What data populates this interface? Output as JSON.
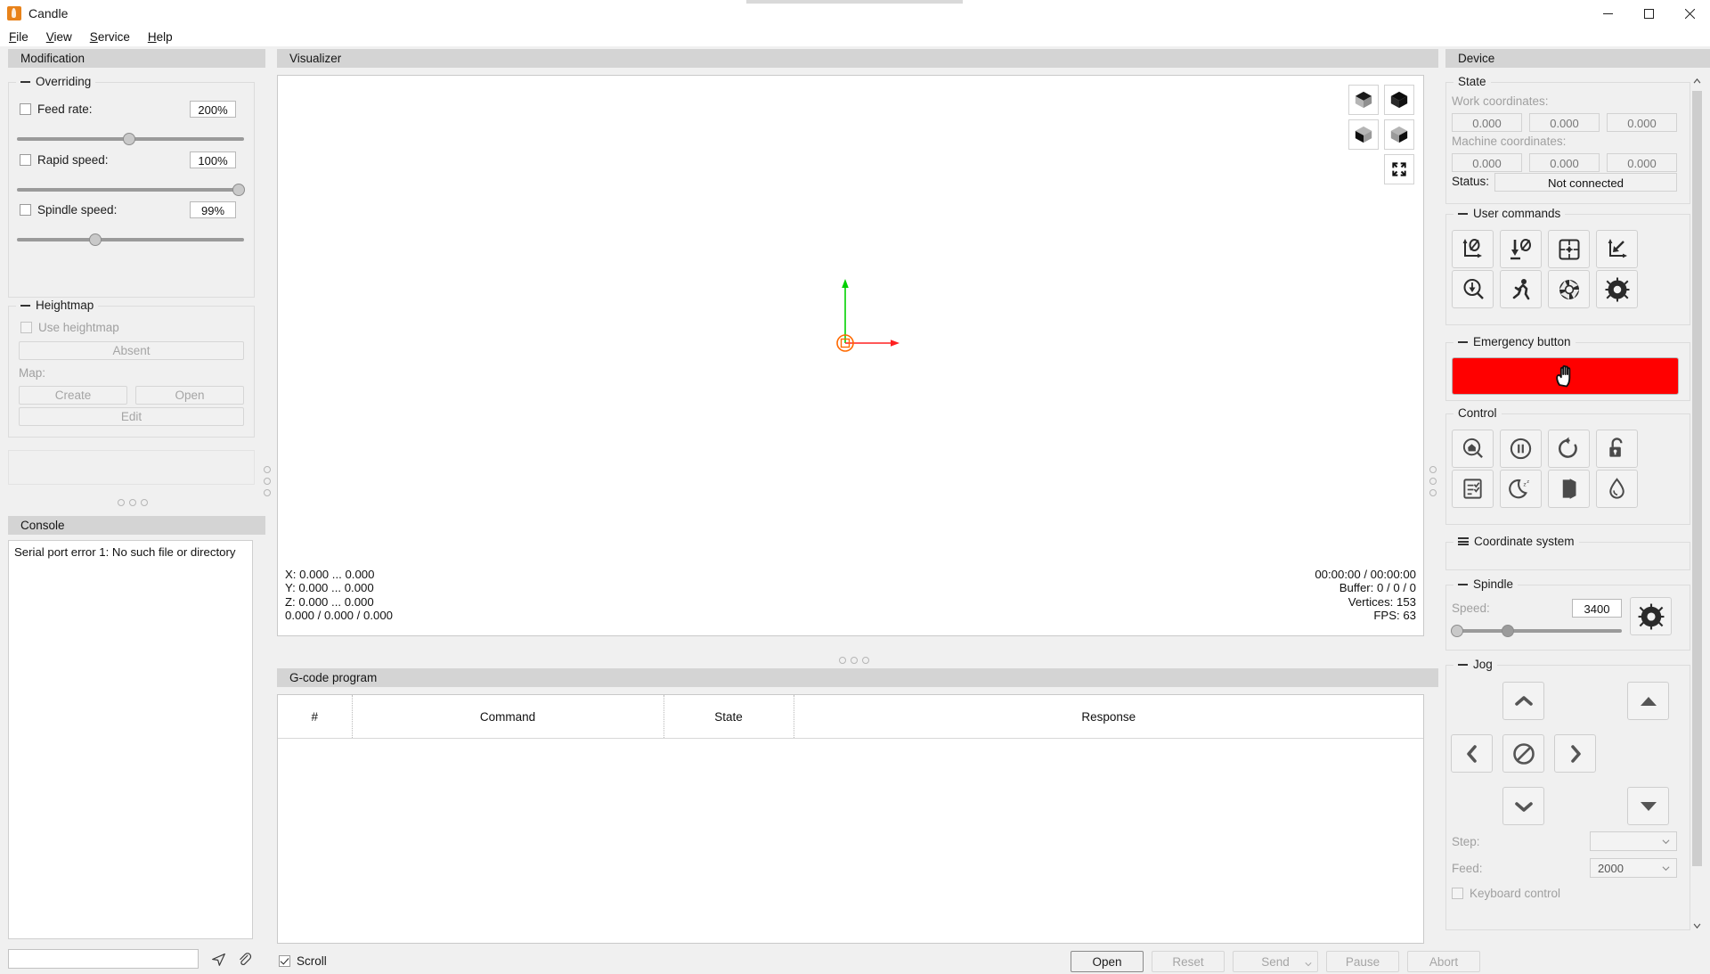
{
  "window": {
    "title": "Candle",
    "buttons": {
      "minimize": "minimize-icon",
      "maximize": "maximize-icon",
      "close": "close-icon"
    }
  },
  "menu": {
    "items": [
      "File",
      "View",
      "Service",
      "Help"
    ]
  },
  "left": {
    "modification_title": "Modification",
    "overriding": {
      "title": "Overriding",
      "feed_rate_label": "Feed rate:",
      "feed_rate_value": "200%",
      "feed_rate_checked": false,
      "rapid_speed_label": "Rapid speed:",
      "rapid_speed_value": "100%",
      "rapid_speed_checked": false,
      "spindle_speed_label": "Spindle speed:",
      "spindle_speed_value": "99%",
      "spindle_speed_checked": false
    },
    "heightmap": {
      "title": "Heightmap",
      "use_heightmap_label": "Use heightmap",
      "use_heightmap_checked": false,
      "absent_label": "Absent",
      "map_label": "Map:",
      "create_label": "Create",
      "open_label": "Open",
      "edit_label": "Edit"
    },
    "console_title": "Console",
    "console_text": "Serial port error 1: No such file or directory",
    "console_input_value": "",
    "send_icon": "send-icon",
    "clear_icon": "paperclip-icon"
  },
  "center": {
    "visualizer_title": "Visualizer",
    "view_buttons": [
      {
        "name": "isometric-view-button",
        "icon": "cube-top-icon"
      },
      {
        "name": "top-view-button",
        "icon": "cube-dark-icon"
      },
      {
        "name": "front-view-button",
        "icon": "cube-left-icon"
      },
      {
        "name": "left-view-button",
        "icon": "cube-right-icon"
      },
      {
        "name": "fit-view-button",
        "icon": "fit-screen-icon"
      }
    ],
    "info_left": "X: 0.000 ... 0.000\nY: 0.000 ... 0.000\nZ: 0.000 ... 0.000\n0.000 / 0.000 / 0.000",
    "info_right": "00:00:00 / 00:00:00\nBuffer: 0 / 0 / 0\nVertices: 153\nFPS: 63",
    "gcode_title": "G-code program",
    "table_headers": [
      "#",
      "Command",
      "State",
      "Response"
    ],
    "table_rows": [],
    "scroll_label": "Scroll",
    "scroll_checked": true,
    "buttons": [
      {
        "label": "Open",
        "enabled": true
      },
      {
        "label": "Reset",
        "enabled": false
      },
      {
        "label": "Send",
        "enabled": false
      },
      {
        "label": "Pause",
        "enabled": false
      },
      {
        "label": "Abort",
        "enabled": false
      }
    ]
  },
  "right": {
    "device_title": "Device",
    "state": {
      "title": "State",
      "work_coordinates_label": "Work coordinates:",
      "work_coordinates": [
        "0.000",
        "0.000",
        "0.000"
      ],
      "machine_coordinates_label": "Machine coordinates:",
      "machine_coordinates": [
        "0.000",
        "0.000",
        "0.000"
      ],
      "status_label": "Status:",
      "status_value": "Not connected"
    },
    "user_commands": {
      "title": "User commands",
      "buttons": [
        "zero-xy-icon",
        "zero-z-icon",
        "safe-position-icon",
        "return-to-zero-icon",
        "probe-icon",
        "run-icon",
        "aperture-icon",
        "spindle-tool-icon"
      ]
    },
    "emergency": {
      "title": "Emergency button",
      "icon": "hand-stop-icon",
      "color": "#ff0000"
    },
    "control": {
      "title": "Control",
      "buttons": [
        "home-search-icon",
        "pause-icon",
        "reset-icon",
        "unlock-icon",
        "check-list-icon",
        "sleep-icon",
        "door-icon",
        "coolant-icon"
      ]
    },
    "coordinate_system": {
      "title": "Coordinate system"
    },
    "spindle": {
      "title": "Spindle",
      "speed_label": "Speed:",
      "speed_value": "3400",
      "tool_icon": "spindle-tool-icon"
    },
    "jog": {
      "title": "Jog",
      "up_icon": "chevron-up-icon",
      "down_icon": "chevron-down-icon",
      "left_icon": "chevron-left-icon",
      "right_icon": "chevron-right-icon",
      "stop_icon": "no-entry-icon",
      "z_up_icon": "triangle-up-icon",
      "z_down_icon": "triangle-down-icon",
      "step_label": "Step:",
      "step_value": "",
      "feed_label": "Feed:",
      "feed_value": "2000",
      "keyboard_control_label": "Keyboard control",
      "keyboard_control_checked": false
    }
  }
}
